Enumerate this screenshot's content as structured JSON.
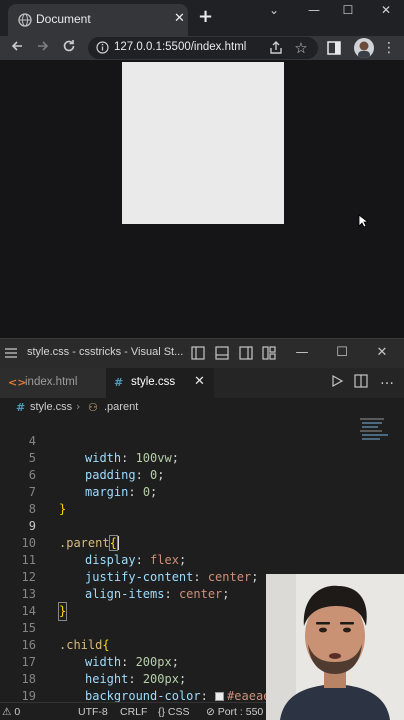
{
  "browser": {
    "tab_title": "Document",
    "new_tab": "+",
    "tab_close": "✕",
    "window_controls": [
      "⌄",
      "—",
      "☐",
      "✕"
    ],
    "url": "127.0.0.1:5500/index.html",
    "icons": [
      "back-arrow-icon",
      "forward-arrow-icon",
      "reload-icon",
      "site-info-icon",
      "share-icon",
      "star-icon",
      "sidebar-icon",
      "profile-avatar",
      "kebab-menu-icon"
    ]
  },
  "page_preview": {
    "box_color": "#eaeaea",
    "background": "#151517"
  },
  "vscode": {
    "title": "style.css - csstricks - Visual St...",
    "tabs": [
      {
        "label": "index.html",
        "icon": "<>",
        "active": false
      },
      {
        "label": "style.css",
        "icon": "#",
        "active": true
      }
    ],
    "breadcrumb": {
      "file": "style.css",
      "selector": ".parent"
    },
    "code_lines": [
      {
        "n": "4",
        "prop": "width",
        "val": "100vw"
      },
      {
        "n": "5",
        "prop": "padding",
        "val": "0"
      },
      {
        "n": "6",
        "prop": "margin",
        "val": "0"
      },
      {
        "n": "7",
        "text": "}"
      },
      {
        "n": "8",
        "text": ""
      },
      {
        "n": "9",
        "selector": ".parent",
        "brace": "{"
      },
      {
        "n": "10",
        "prop": "display",
        "val": "flex"
      },
      {
        "n": "11",
        "prop": "justify-content",
        "val": "center"
      },
      {
        "n": "12",
        "prop": "align-items",
        "val": "center"
      },
      {
        "n": "13",
        "text": "}"
      },
      {
        "n": "14",
        "text": ""
      },
      {
        "n": "15",
        "selector": ".child",
        "brace": "{"
      },
      {
        "n": "16",
        "prop": "width",
        "val": "200px"
      },
      {
        "n": "17",
        "prop": "height",
        "val": "200px"
      },
      {
        "n": "18",
        "prop": "background-color",
        "val": "#eaeae"
      },
      {
        "n": "19",
        "text": "}"
      },
      {
        "n": "20",
        "text": ""
      }
    ],
    "status": {
      "errors": "⚠ 0",
      "encoding": "UTF-8",
      "eol": "CRLF",
      "language": "{} CSS",
      "port": "⊘ Port : 550"
    }
  },
  "colors": {
    "editor_bg": "#1e1e1e",
    "selector": "#d7ba7d",
    "property": "#9cdcfe",
    "value": "#ce9178",
    "number": "#b5cea8"
  }
}
